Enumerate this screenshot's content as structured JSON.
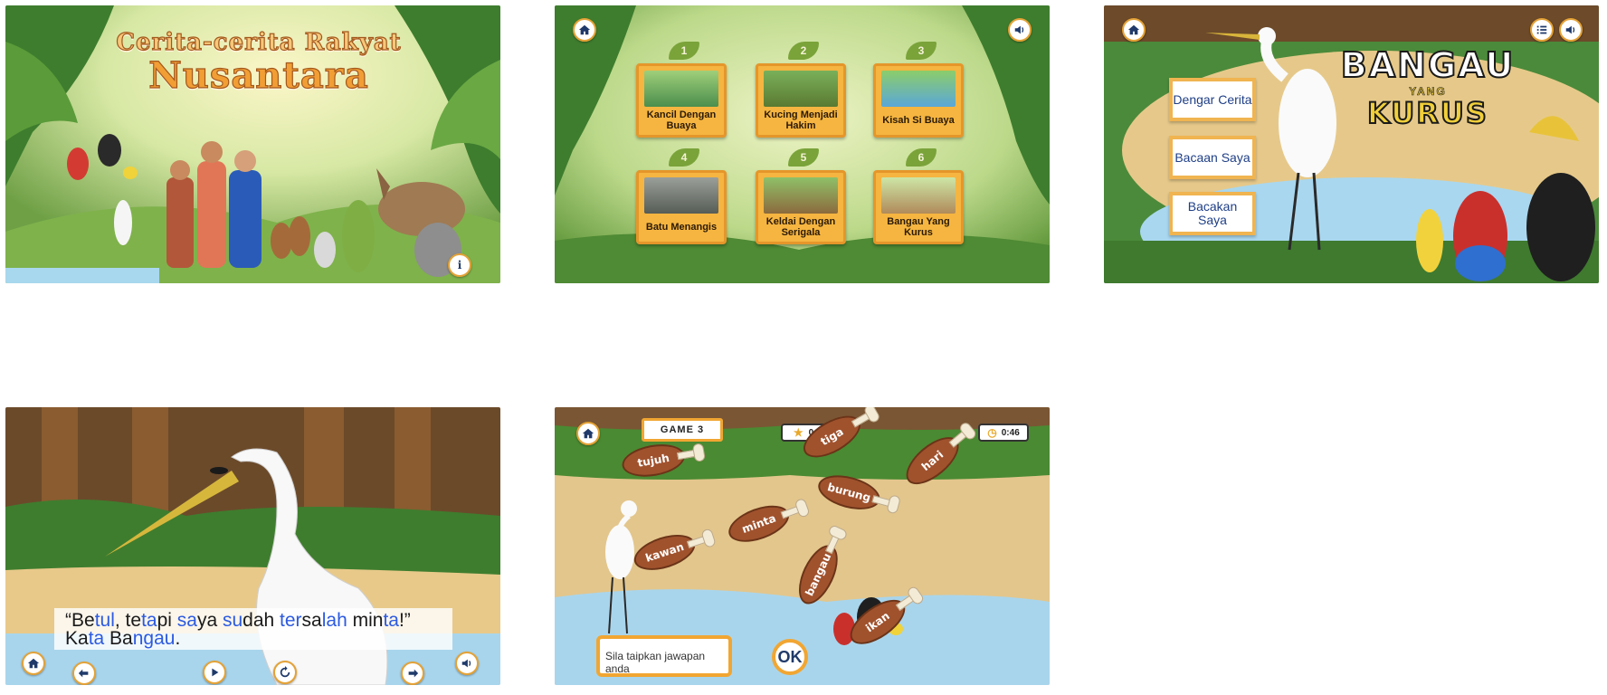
{
  "screen1": {
    "title_line1": "Cerita-cerita Rakyat",
    "title_line2": "Nusantara",
    "info_label": "i"
  },
  "screen2": {
    "stories": [
      {
        "number": "1",
        "title": "Kancil Dengan Buaya"
      },
      {
        "number": "2",
        "title": "Kucing Menjadi Hakim"
      },
      {
        "number": "3",
        "title": "Kisah Si Buaya"
      },
      {
        "number": "4",
        "title": "Batu Menangis"
      },
      {
        "number": "5",
        "title": "Keldai Dengan Serigala"
      },
      {
        "number": "6",
        "title": "Bangau Yang Kurus"
      }
    ]
  },
  "screen3": {
    "menu": [
      {
        "label": "Dengar Cerita"
      },
      {
        "label": "Bacaan Saya"
      },
      {
        "label": "Bacakan Saya"
      }
    ],
    "title_line1": "BANGAU",
    "title_line2": "YANG",
    "title_line3": "KURUS"
  },
  "screen4": {
    "sentence_segments": [
      {
        "text": "“Be",
        "highlight": false
      },
      {
        "text": "tul",
        "highlight": true
      },
      {
        "text": ", te",
        "highlight": false
      },
      {
        "text": "ta",
        "highlight": true
      },
      {
        "text": "pi ",
        "highlight": false
      },
      {
        "text": "sa",
        "highlight": true
      },
      {
        "text": "ya ",
        "highlight": false
      },
      {
        "text": "su",
        "highlight": true
      },
      {
        "text": "dah ",
        "highlight": false
      },
      {
        "text": "ter",
        "highlight": true
      },
      {
        "text": "sa",
        "highlight": false
      },
      {
        "text": "lah",
        "highlight": true
      },
      {
        "text": " min",
        "highlight": false
      },
      {
        "text": "ta",
        "highlight": true
      },
      {
        "text": "!” Ka",
        "highlight": false
      },
      {
        "text": "ta",
        "highlight": true
      },
      {
        "text": " Ba",
        "highlight": false
      },
      {
        "text": "ngau",
        "highlight": true
      },
      {
        "text": ".",
        "highlight": false
      }
    ],
    "highlight_color": "#2c5ae0"
  },
  "screen5": {
    "game_label": "GAME 3",
    "score": "0",
    "timer": "0:46",
    "words": [
      "tujuh",
      "tiga",
      "hari",
      "burung",
      "minta",
      "kawan",
      "bangau",
      "ikan"
    ],
    "answer_placeholder": "Sila taipkan jawapan anda",
    "ok_label": "OK"
  },
  "colors": {
    "accent_orange": "#f1a632",
    "navy": "#1f3a6a",
    "highlight_blue": "#2c5ae0"
  }
}
